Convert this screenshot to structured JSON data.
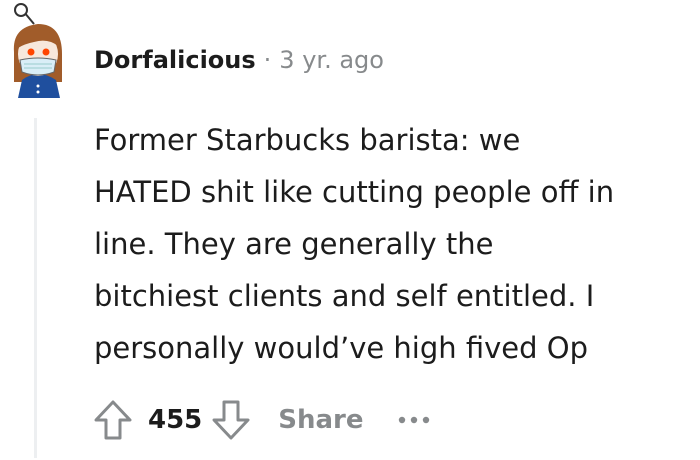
{
  "comment": {
    "author": "Dorfalicious",
    "separator": "·",
    "age": "3 yr. ago",
    "body_lines": [
      "Former Starbucks barista: we",
      "HATED shit like cutting people off in",
      "line. They are generally the",
      "bitchiest clients and self entitled. I",
      "personally would’ve high fived Op"
    ],
    "score": "455",
    "share_label": "Share"
  },
  "icons": {
    "avatar": "snoo-avatar-icon",
    "upvote": "upvote-arrow-icon",
    "downvote": "downvote-arrow-icon",
    "more": "more-options-icon"
  },
  "colors": {
    "text": "#1c1c1c",
    "muted": "#878a8c",
    "thread_line": "#edeff1"
  }
}
